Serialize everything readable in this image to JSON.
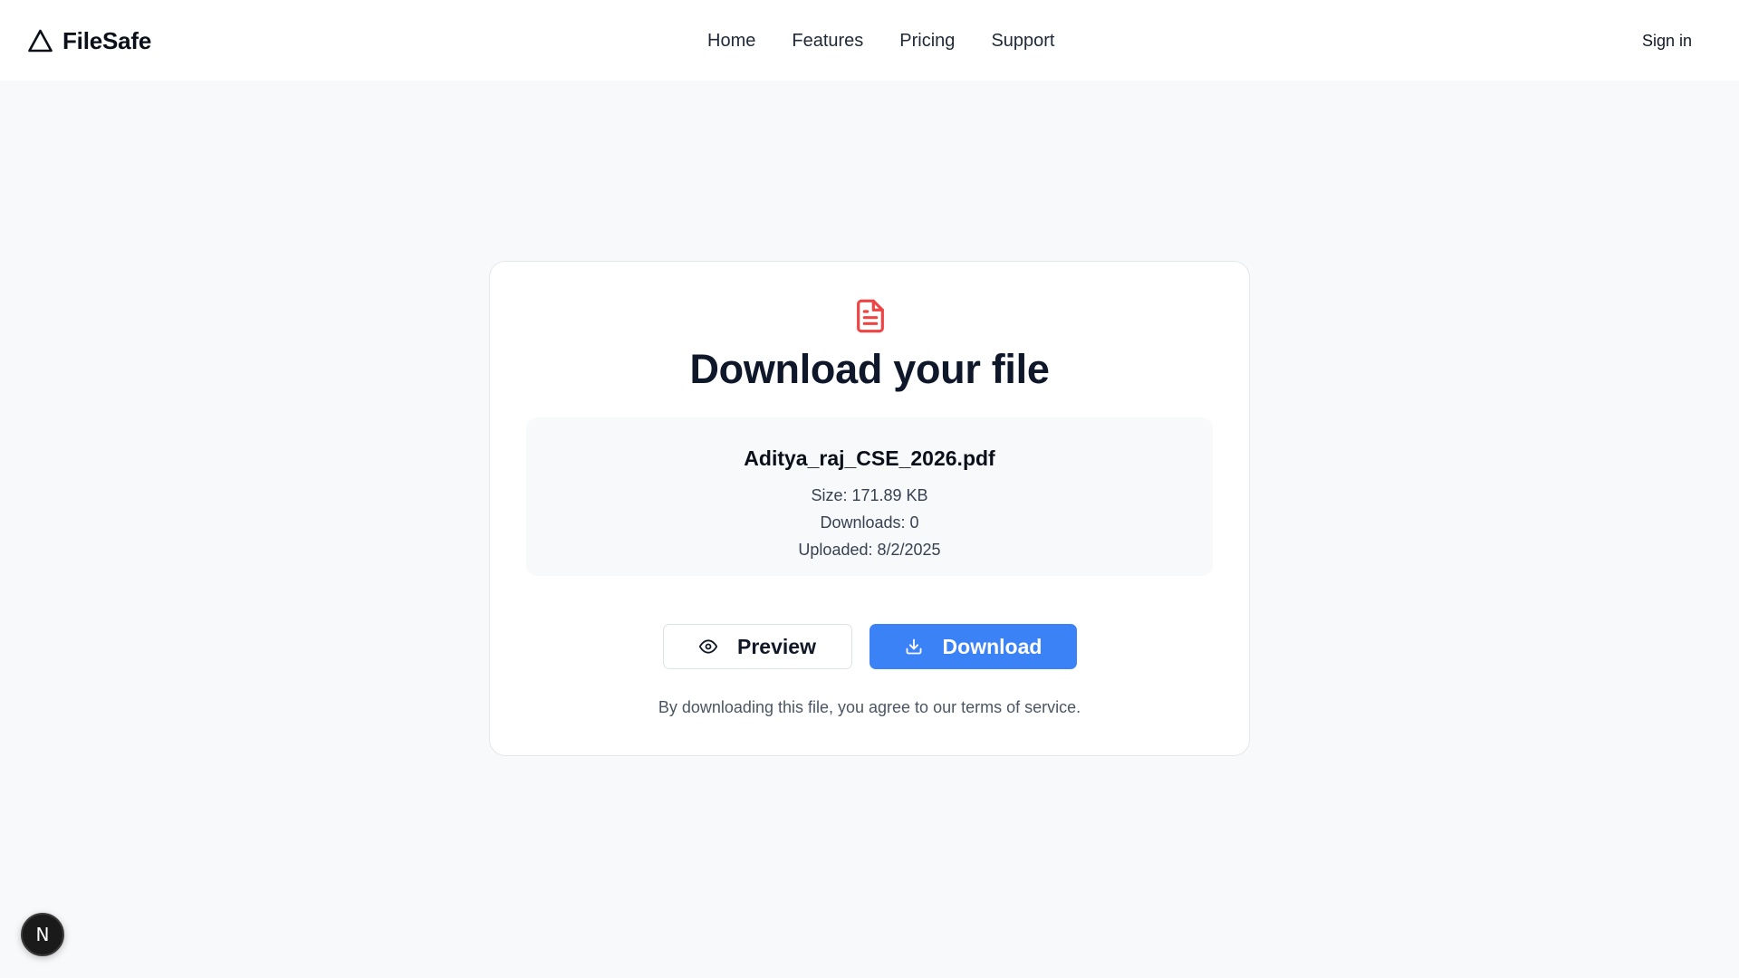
{
  "brand": {
    "name": "FileSafe",
    "icon": "triangle-logo-icon"
  },
  "nav": {
    "items": [
      "Home",
      "Features",
      "Pricing",
      "Support"
    ]
  },
  "header": {
    "signin_label": "Sign in"
  },
  "card": {
    "icon": "file-text-icon",
    "icon_color": "#ef4444",
    "title": "Download your file",
    "file": {
      "name": "Aditya_raj_CSE_2026.pdf",
      "size": "Size: 171.89 KB",
      "downloads": "Downloads: 0",
      "uploaded": "Uploaded: 8/2/2025"
    },
    "preview_label": "Preview",
    "preview_icon": "eye-icon",
    "download_label": "Download",
    "download_icon": "download-icon",
    "terms": "By downloading this file, you agree to our terms of service."
  },
  "colors": {
    "accent": "#3b82f6",
    "page_bg": "#f8f9fb"
  },
  "floating_badge": {
    "letter": "N"
  }
}
